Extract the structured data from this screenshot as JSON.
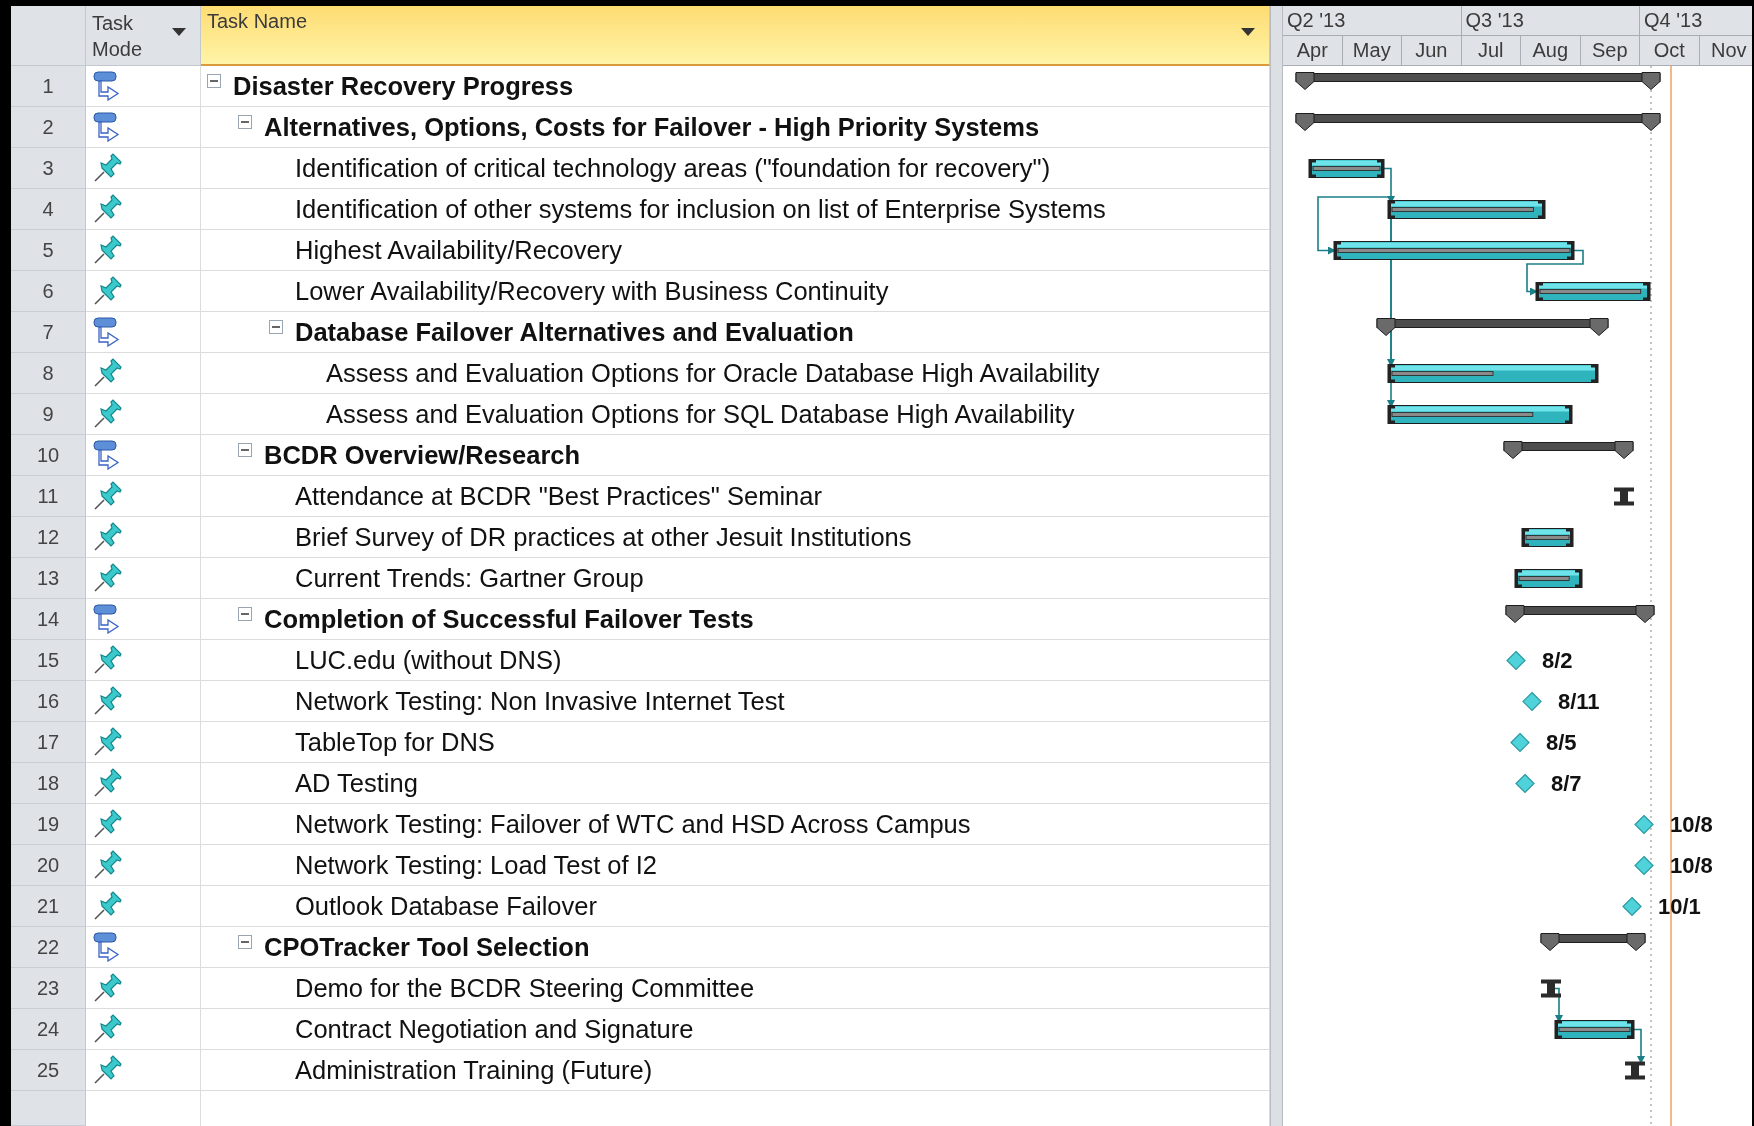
{
  "columns": [
    {
      "label": "Task Mode",
      "selected": false
    },
    {
      "label": "Task Name",
      "selected": true
    }
  ],
  "timescale": [
    {
      "label": "Q2 '13",
      "months": [
        "Apr",
        "May",
        "Jun"
      ]
    },
    {
      "label": "Q3 '13",
      "months": [
        "Jul",
        "Aug",
        "Sep"
      ]
    },
    {
      "label": "Q4 '13",
      "months": [
        "Oct",
        "Nov"
      ]
    }
  ],
  "tasks": [
    {
      "id": "1",
      "kind": "auto",
      "name": "Disaster Recovery Progress",
      "expanded": true,
      "bar": {
        "kind": "summary"
      },
      "children": [
        {
          "id": "2",
          "kind": "auto",
          "name": "Alternatives, Options, Costs for Failover - High Priority Systems",
          "expanded": true,
          "bar": {
            "kind": "summary"
          },
          "children": [
            {
              "id": "3",
              "kind": "manual",
              "name": "Identification of critical technology areas (\"foundation for recovery\")",
              "bar": {
                "kind": "task",
                "level": 1
              }
            },
            {
              "id": "4",
              "kind": "manual",
              "name": "Identification of other systems for inclusion on list of Enterprise Systems",
              "bar": {
                "kind": "task",
                "level": 0.95
              }
            },
            {
              "id": "5",
              "kind": "manual",
              "name": "Highest Availability/Recovery",
              "bar": {
                "kind": "task",
                "level": 1
              }
            },
            {
              "id": "6",
              "kind": "manual",
              "name": "Lower Availability/Recovery with Business Continuity",
              "bar": {
                "kind": "task",
                "level": 0.95
              }
            },
            {
              "id": "7",
              "kind": "auto",
              "name": "Database Failover Alternatives and Evaluation",
              "expanded": true,
              "bar": {
                "kind": "summary"
              },
              "children": [
                {
                  "id": "8",
                  "kind": "manual",
                  "name": "Assess and Evaluation Options for Oracle Database High Availability",
                  "bar": {
                    "kind": "task",
                    "level": 0.5
                  }
                },
                {
                  "id": "9",
                  "kind": "manual",
                  "name": "Assess and Evaluation Options for SQL Database High Availability",
                  "bar": {
                    "kind": "task",
                    "level": 0.8
                  }
                }
              ]
            }
          ]
        },
        {
          "id": "10",
          "kind": "auto",
          "name": "BCDR Overview/Research",
          "expanded": true,
          "bar": {
            "kind": "summary"
          },
          "children": [
            {
              "id": "11",
              "kind": "manual",
              "name": "Attendance at BCDR \"Best Practices\" Seminar",
              "bar": {
                "kind": "placeholder"
              }
            },
            {
              "id": "12",
              "kind": "manual",
              "name": "Brief Survey of DR practices at other Jesuit Institutions",
              "bar": {
                "kind": "task",
                "level": 1
              }
            },
            {
              "id": "13",
              "kind": "manual",
              "name": "Current Trends: Gartner Group",
              "bar": {
                "kind": "task",
                "level": 0.85
              }
            }
          ]
        },
        {
          "id": "14",
          "kind": "auto",
          "name": "Completion of Successful Failover Tests",
          "expanded": true,
          "bar": {
            "kind": "summary"
          },
          "children": [
            {
              "id": "15",
              "kind": "manual",
              "name": "LUC.edu (without DNS)",
              "bar": {
                "kind": "milestone",
                "label": "8/2"
              }
            },
            {
              "id": "16",
              "kind": "manual",
              "name": "Network Testing: Non Invasive Internet Test",
              "bar": {
                "kind": "milestone",
                "label": "8/11"
              }
            },
            {
              "id": "17",
              "kind": "manual",
              "name": "TableTop for DNS",
              "bar": {
                "kind": "milestone",
                "label": "8/5"
              }
            },
            {
              "id": "18",
              "kind": "manual",
              "name": "AD Testing",
              "bar": {
                "kind": "milestone",
                "label": "8/7"
              }
            },
            {
              "id": "19",
              "kind": "manual",
              "name": "Network Testing: Failover of WTC and HSD Across Campus",
              "bar": {
                "kind": "milestone",
                "label": "10/8"
              }
            },
            {
              "id": "20",
              "kind": "manual",
              "name": "Network Testing: Load Test of I2",
              "bar": {
                "kind": "milestone",
                "label": "10/8"
              }
            },
            {
              "id": "21",
              "kind": "manual",
              "name": "Outlook Database Failover",
              "bar": {
                "kind": "milestone",
                "label": "10/1"
              }
            }
          ]
        },
        {
          "id": "22",
          "kind": "auto",
          "name": "CPOTracker Tool Selection",
          "expanded": true,
          "bar": {
            "kind": "summary"
          },
          "children": [
            {
              "id": "23",
              "kind": "manual",
              "name": "Demo for the BCDR Steering Committee",
              "bar": {
                "kind": "placeholder"
              }
            },
            {
              "id": "24",
              "kind": "manual",
              "name": "Contract Negotiation and Signature",
              "bar": {
                "kind": "task",
                "level": 1
              }
            },
            {
              "id": "25",
              "kind": "manual",
              "name": "Administration Training (Future)",
              "bar": {
                "kind": "placeholder"
              }
            }
          ]
        }
      ]
    }
  ]
}
